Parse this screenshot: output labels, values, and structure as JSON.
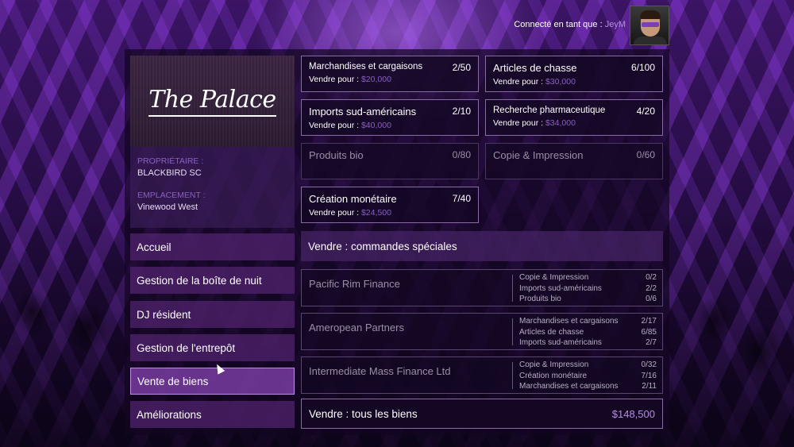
{
  "header": {
    "connected_label": "Connecté en tant que :",
    "username": "JeyM"
  },
  "club": {
    "logo": "The Palace",
    "owner_label": "PROPRIÉTAIRE :",
    "owner": "BLACKBIRD SC",
    "location_label": "EMPLACEMENT :",
    "location": "Vinewood West"
  },
  "menu": [
    {
      "label": "Accueil"
    },
    {
      "label": "Gestion de la boîte de nuit"
    },
    {
      "label": "DJ résident"
    },
    {
      "label": "Gestion de l'entrepôt"
    },
    {
      "label": "Vente de biens"
    },
    {
      "label": "Améliorations"
    }
  ],
  "goods": [
    {
      "name": "Marchandises et cargaisons",
      "count": "2/50",
      "sell_label": "Vendre pour :",
      "price": "$20,000"
    },
    {
      "name": "Articles de chasse",
      "count": "6/100",
      "sell_label": "Vendre pour :",
      "price": "$30,000"
    },
    {
      "name": "Imports sud-américains",
      "count": "2/10",
      "sell_label": "Vendre pour :",
      "price": "$40,000"
    },
    {
      "name": "Recherche pharmaceutique",
      "count": "4/20",
      "sell_label": "Vendre pour :",
      "price": "$34,000"
    },
    {
      "name": "Produits bio",
      "count": "0/80"
    },
    {
      "name": "Copie & Impression",
      "count": "0/60"
    },
    {
      "name": "Création monétaire",
      "count": "7/40",
      "sell_label": "Vendre pour :",
      "price": "$24,500"
    }
  ],
  "special_orders": {
    "title": "Vendre : commandes spéciales",
    "orders": [
      {
        "name": "Pacific Rim Finance",
        "lines": [
          {
            "item": "Copie & Impression",
            "qty": "0/2"
          },
          {
            "item": "Imports sud-américains",
            "qty": "2/2"
          },
          {
            "item": "Produits bio",
            "qty": "0/6"
          }
        ]
      },
      {
        "name": "Ameropean Partners",
        "lines": [
          {
            "item": "Marchandises et cargaisons",
            "qty": "2/17"
          },
          {
            "item": "Articles de chasse",
            "qty": "6/85"
          },
          {
            "item": "Imports sud-américains",
            "qty": "2/7"
          }
        ]
      },
      {
        "name": "Intermediate Mass Finance Ltd",
        "lines": [
          {
            "item": "Copie & Impression",
            "qty": "0/32"
          },
          {
            "item": "Création monétaire",
            "qty": "7/16"
          },
          {
            "item": "Marchandises et cargaisons",
            "qty": "2/11"
          }
        ]
      }
    ]
  },
  "sell_all": {
    "label": "Vendre : tous les biens",
    "total": "$148,500"
  },
  "colors": {
    "accent": "#8a5fc0",
    "price": "#8a5fc0",
    "panel": "#2a1040"
  }
}
